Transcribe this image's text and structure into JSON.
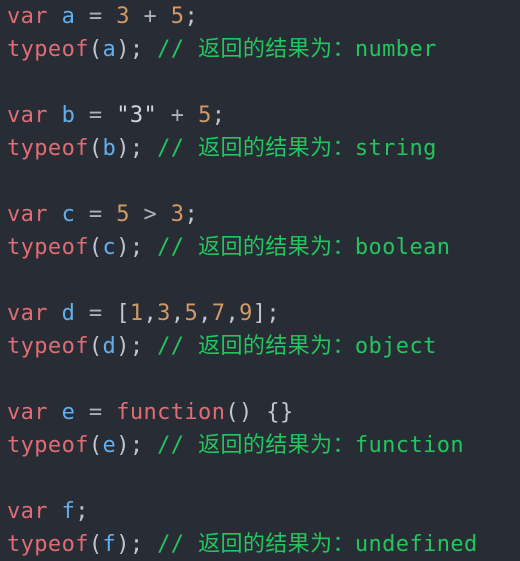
{
  "editor": {
    "theme": {
      "background": "#282c34",
      "keyword": "#e06c75",
      "identifier": "#61afef",
      "number": "#d19a66",
      "comment": "#22c55e",
      "text": "#abb2bf"
    },
    "lines": [
      [
        {
          "t": "var",
          "c": "kw"
        },
        {
          "t": " ",
          "c": "op"
        },
        {
          "t": "a",
          "c": "id"
        },
        {
          "t": " = ",
          "c": "op"
        },
        {
          "t": "3",
          "c": "num"
        },
        {
          "t": " + ",
          "c": "op"
        },
        {
          "t": "5",
          "c": "num"
        },
        {
          "t": ";",
          "c": "punc"
        }
      ],
      [
        {
          "t": "typeof",
          "c": "kw"
        },
        {
          "t": "(",
          "c": "punc"
        },
        {
          "t": "a",
          "c": "id"
        },
        {
          "t": ");",
          "c": "punc"
        },
        {
          "t": " ",
          "c": "op"
        },
        {
          "t": "// 返回的结果为：number",
          "c": "cm"
        }
      ],
      [],
      [
        {
          "t": "var",
          "c": "kw"
        },
        {
          "t": " ",
          "c": "op"
        },
        {
          "t": "b",
          "c": "id"
        },
        {
          "t": " = ",
          "c": "op"
        },
        {
          "t": "\"3\"",
          "c": "str"
        },
        {
          "t": " + ",
          "c": "op"
        },
        {
          "t": "5",
          "c": "num"
        },
        {
          "t": ";",
          "c": "punc"
        }
      ],
      [
        {
          "t": "typeof",
          "c": "kw"
        },
        {
          "t": "(",
          "c": "punc"
        },
        {
          "t": "b",
          "c": "id"
        },
        {
          "t": ");",
          "c": "punc"
        },
        {
          "t": " ",
          "c": "op"
        },
        {
          "t": "// 返回的结果为：string",
          "c": "cm"
        }
      ],
      [],
      [
        {
          "t": "var",
          "c": "kw"
        },
        {
          "t": " ",
          "c": "op"
        },
        {
          "t": "c",
          "c": "id"
        },
        {
          "t": " = ",
          "c": "op"
        },
        {
          "t": "5",
          "c": "num"
        },
        {
          "t": " > ",
          "c": "op"
        },
        {
          "t": "3",
          "c": "num"
        },
        {
          "t": ";",
          "c": "punc"
        }
      ],
      [
        {
          "t": "typeof",
          "c": "kw"
        },
        {
          "t": "(",
          "c": "punc"
        },
        {
          "t": "c",
          "c": "id"
        },
        {
          "t": ");",
          "c": "punc"
        },
        {
          "t": " ",
          "c": "op"
        },
        {
          "t": "// 返回的结果为：boolean",
          "c": "cm"
        }
      ],
      [],
      [
        {
          "t": "var",
          "c": "kw"
        },
        {
          "t": " ",
          "c": "op"
        },
        {
          "t": "d",
          "c": "id"
        },
        {
          "t": " = ",
          "c": "op"
        },
        {
          "t": "[",
          "c": "punc"
        },
        {
          "t": "1",
          "c": "num"
        },
        {
          "t": ",",
          "c": "punc"
        },
        {
          "t": "3",
          "c": "num"
        },
        {
          "t": ",",
          "c": "punc"
        },
        {
          "t": "5",
          "c": "num"
        },
        {
          "t": ",",
          "c": "punc"
        },
        {
          "t": "7",
          "c": "num"
        },
        {
          "t": ",",
          "c": "punc"
        },
        {
          "t": "9",
          "c": "num"
        },
        {
          "t": "];",
          "c": "punc"
        }
      ],
      [
        {
          "t": "typeof",
          "c": "kw"
        },
        {
          "t": "(",
          "c": "punc"
        },
        {
          "t": "d",
          "c": "id"
        },
        {
          "t": ");",
          "c": "punc"
        },
        {
          "t": " ",
          "c": "op"
        },
        {
          "t": "// 返回的结果为：object",
          "c": "cm"
        }
      ],
      [],
      [
        {
          "t": "var",
          "c": "kw"
        },
        {
          "t": " ",
          "c": "op"
        },
        {
          "t": "e",
          "c": "id"
        },
        {
          "t": " = ",
          "c": "op"
        },
        {
          "t": "function",
          "c": "kw"
        },
        {
          "t": "() {}",
          "c": "punc"
        }
      ],
      [
        {
          "t": "typeof",
          "c": "kw"
        },
        {
          "t": "(",
          "c": "punc"
        },
        {
          "t": "e",
          "c": "id"
        },
        {
          "t": ");",
          "c": "punc"
        },
        {
          "t": " ",
          "c": "op"
        },
        {
          "t": "// 返回的结果为：function",
          "c": "cm"
        }
      ],
      [],
      [
        {
          "t": "var",
          "c": "kw"
        },
        {
          "t": " ",
          "c": "op"
        },
        {
          "t": "f",
          "c": "id"
        },
        {
          "t": ";",
          "c": "punc"
        }
      ],
      [
        {
          "t": "typeof",
          "c": "kw"
        },
        {
          "t": "(",
          "c": "punc"
        },
        {
          "t": "f",
          "c": "id"
        },
        {
          "t": ");",
          "c": "punc"
        },
        {
          "t": " ",
          "c": "op"
        },
        {
          "t": "// 返回的结果为：undefined",
          "c": "cm"
        }
      ]
    ]
  }
}
